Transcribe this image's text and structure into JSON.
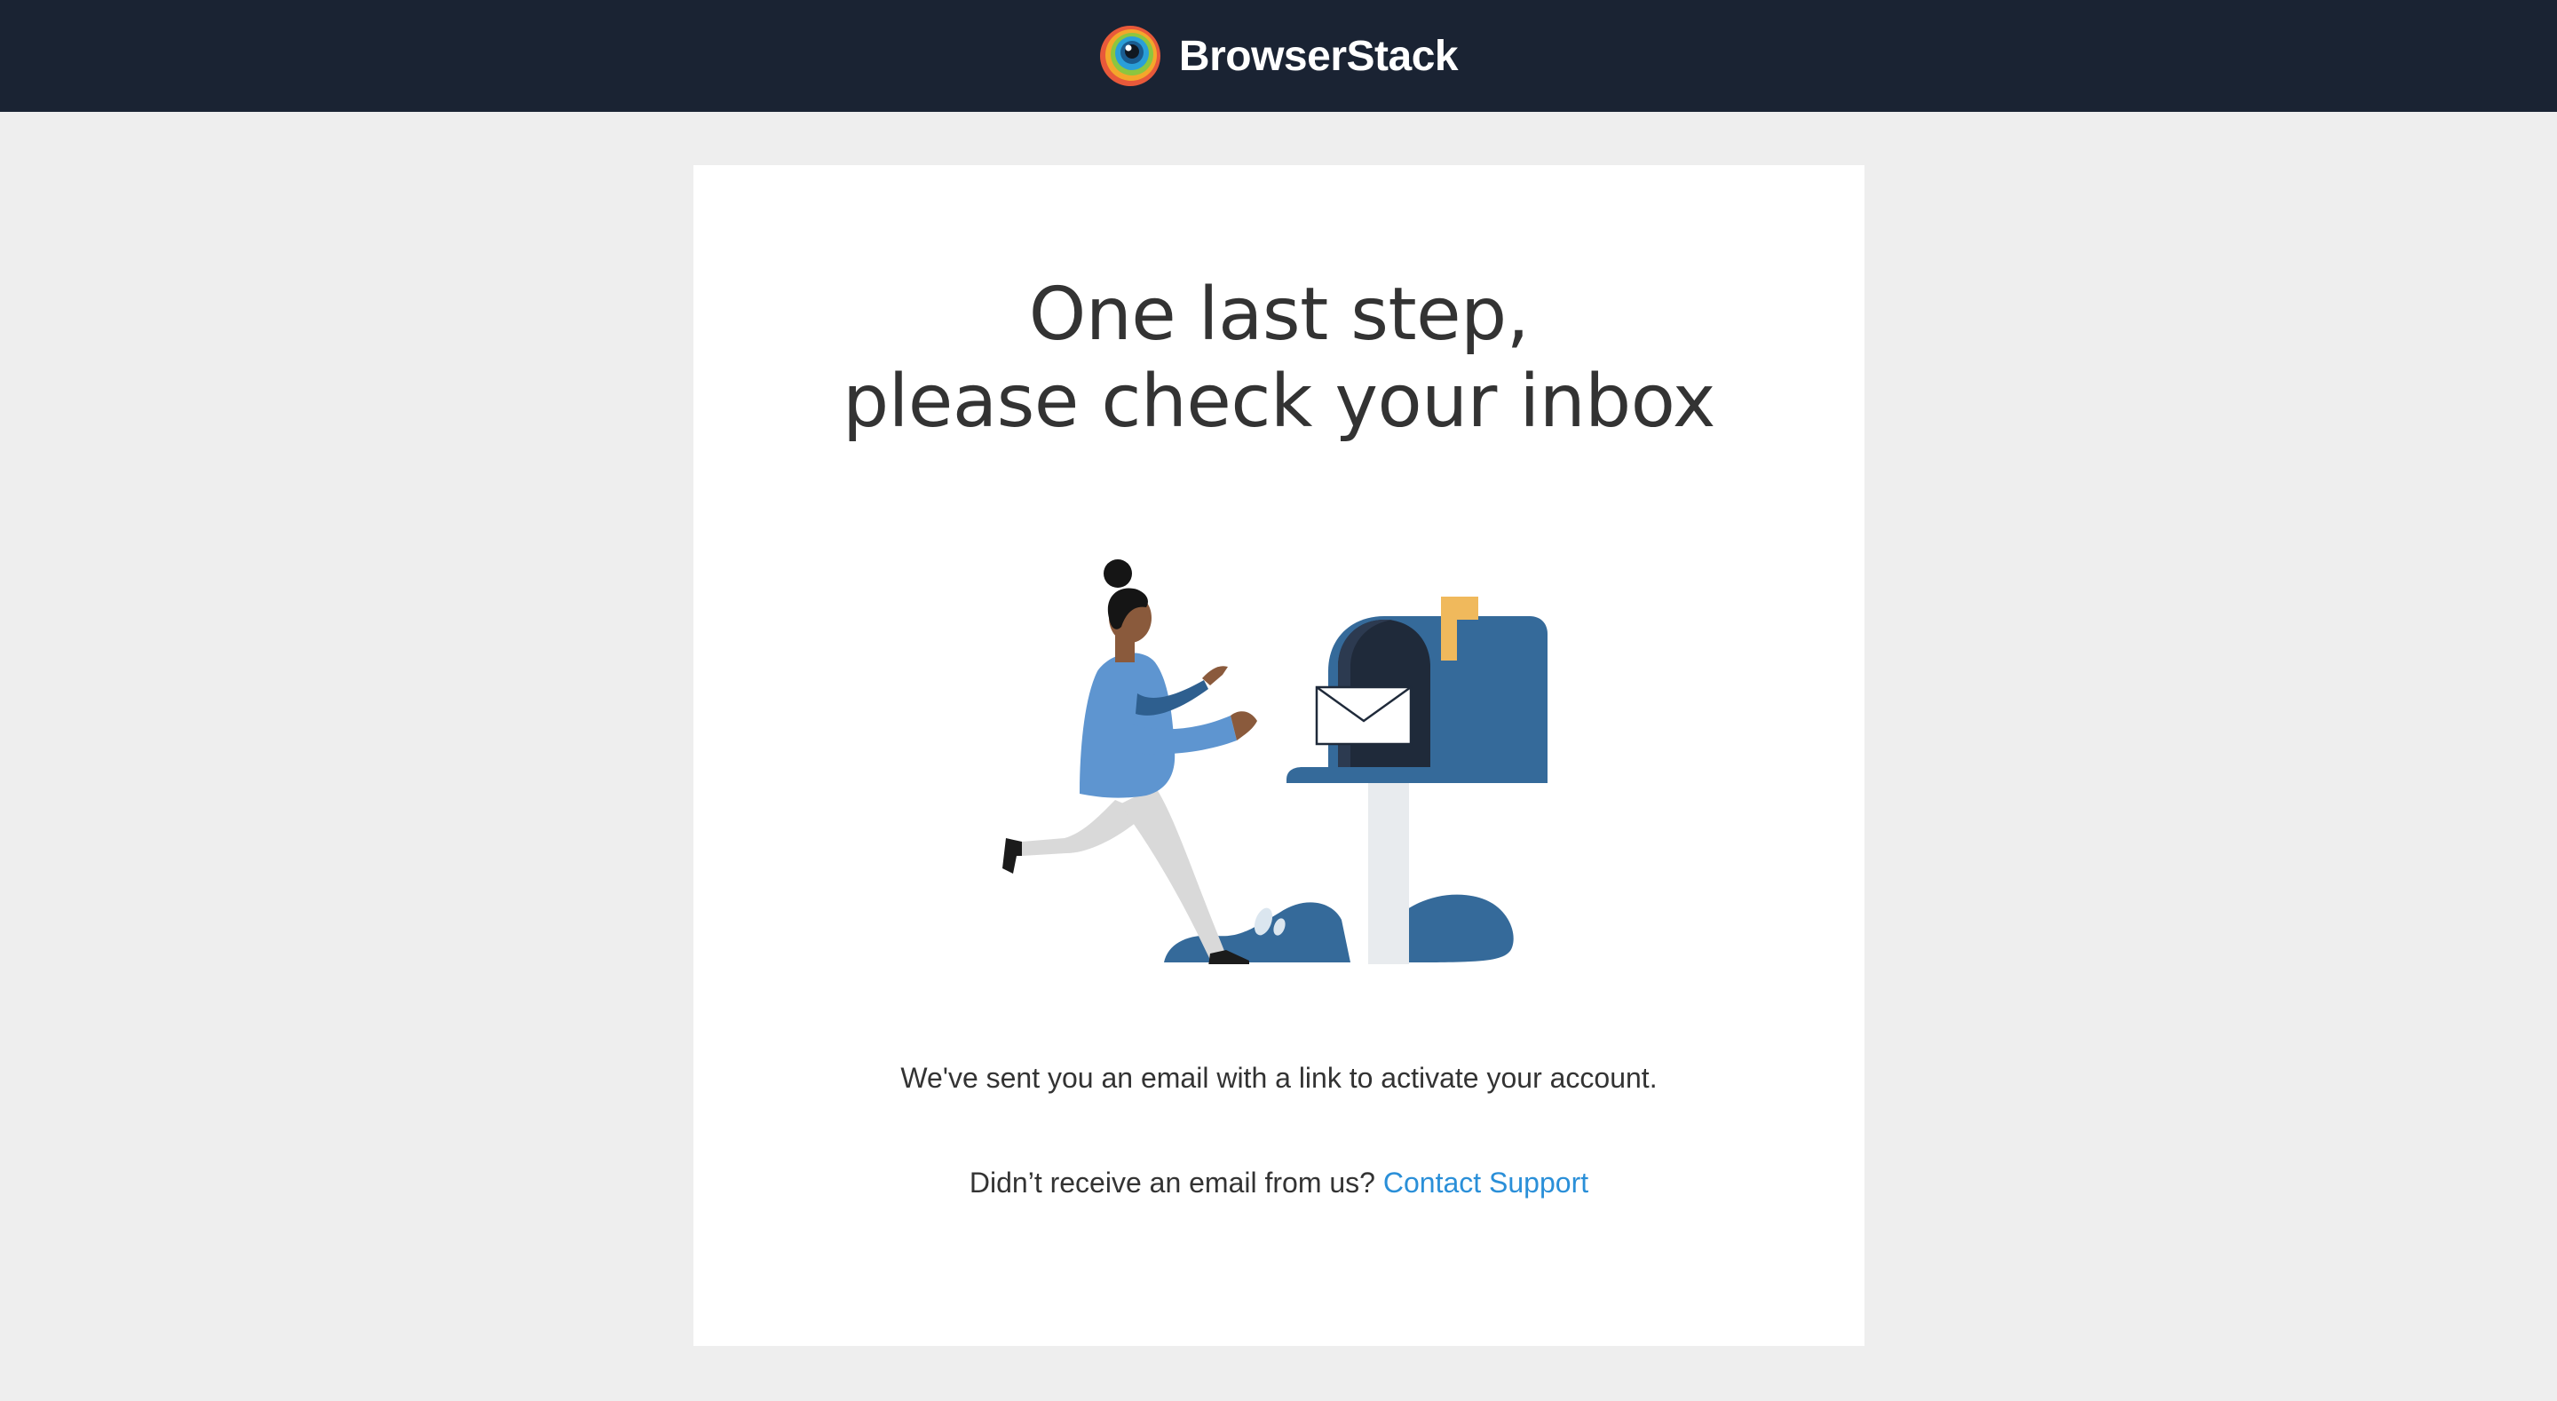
{
  "header": {
    "brand_name": "BrowserStack",
    "logo_icon": "browserstack-eye-logo-icon",
    "background_color": "#1a2333"
  },
  "card": {
    "title_line_1": "One last step,",
    "title_line_2": "please check your inbox",
    "illustration": "woman-posting-letter-to-mailbox-illustration",
    "message": "We've sent you an email with a link to activate your account.",
    "support_prompt": "Didn’t receive an email from us? ",
    "support_link_label": "Contact Support",
    "link_color": "#2a8fd8"
  },
  "colors": {
    "page_background": "#eeeeee",
    "card_background": "#ffffff",
    "mailbox_blue": "#356a9a",
    "flag_yellow": "#f0b95c"
  }
}
